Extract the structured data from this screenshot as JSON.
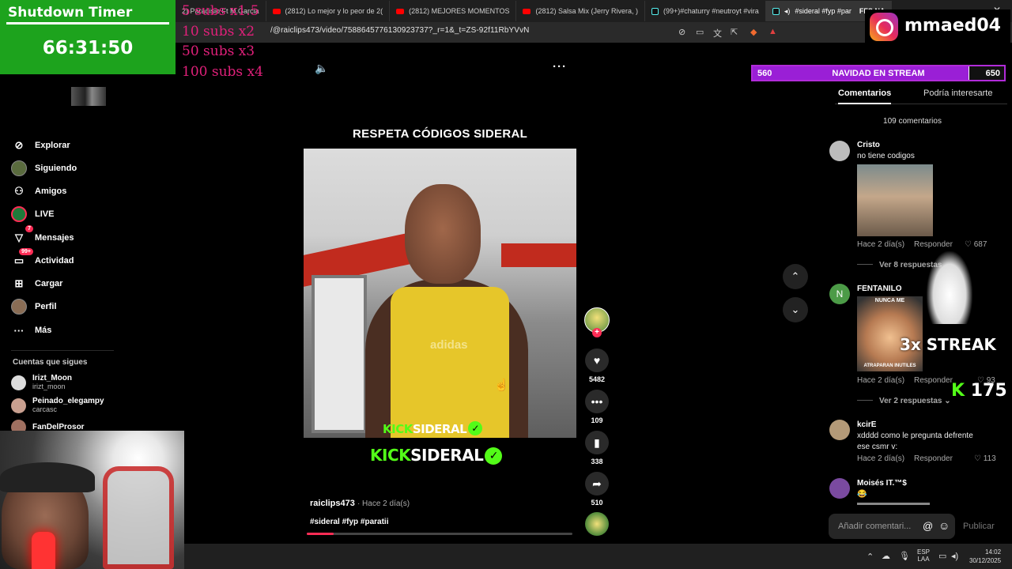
{
  "overlay": {
    "timer_title": "Shutdown Timer",
    "timer_value": "66:31:50",
    "subs_lines": [
      "5 subs x1.5",
      "10 subs x2",
      "50 subs x3",
      "100 subs x4"
    ],
    "instagram_handle": "mmaed04",
    "goal": {
      "left": "560",
      "title": "NAVIDAD EN STREAM",
      "right": "650",
      "progress_fraction": 0.86
    },
    "streak_text": "3x STREAK",
    "kick_count": "175"
  },
  "browser": {
    "tabs": [
      {
        "label": "2) Paradisio Ft M.Garcia",
        "icon": "youtube-icon",
        "active": false
      },
      {
        "label": "(2812) Lo mejor y lo peor de 2(",
        "icon": "youtube-icon",
        "active": false
      },
      {
        "label": "(2812) MEJORES MOMENTOS",
        "icon": "youtube-icon",
        "active": false
      },
      {
        "label": "(2812) Salsa Mix (Jerry Rivera, )",
        "icon": "youtube-icon",
        "active": false
      },
      {
        "label": "(99+)#chaturry #neutroyt #vira",
        "icon": "tiktok-icon",
        "active": false
      },
      {
        "label": "#sideral #fyp #par",
        "icon": "tiktok-icon",
        "active": true
      }
    ],
    "url": "/@raiclips473/video/7588645776130923737?_r=1&_t=ZS-92f11RbYVvN",
    "tab_overflow_text": "FFS NA"
  },
  "sidebar": {
    "items": [
      {
        "label": "Explorar",
        "icon": "compass-icon"
      },
      {
        "label": "Siguiendo",
        "icon": "following-avatar-icon"
      },
      {
        "label": "Amigos",
        "icon": "friends-icon"
      },
      {
        "label": "LIVE",
        "icon": "live-icon"
      },
      {
        "label": "Mensajes",
        "icon": "messages-icon",
        "badge": "7"
      },
      {
        "label": "Actividad",
        "icon": "activity-icon",
        "badge": "99+"
      },
      {
        "label": "Cargar",
        "icon": "upload-icon"
      },
      {
        "label": "Perfil",
        "icon": "profile-icon"
      },
      {
        "label": "Más",
        "icon": "more-icon"
      }
    ],
    "following_header": "Cuentas que sigues",
    "accounts": [
      {
        "name": "Irizt_Moon",
        "handle": "irizt_moon"
      },
      {
        "name": "Peinado_elegampy",
        "handle": "carcasc"
      },
      {
        "name": "FanDelProsor",
        "handle": ""
      }
    ]
  },
  "video": {
    "title": "RESPETA CÓDIGOS SIDERAL",
    "watermark_inner_green": "KICK",
    "watermark_inner_white": "SIDERAL",
    "watermark_outer_green": "KICK",
    "watermark_outer_white": "SIDERAL",
    "shirt_brand": "adidas",
    "author": "raiclips473",
    "posted": "· Hace 2 día(s)",
    "hashtags": "#sideral #fyp #paratii",
    "progress_fraction": 0.1,
    "actions": {
      "likes": "5482",
      "comments": "109",
      "saves": "338",
      "shares": "510"
    }
  },
  "comments": {
    "tab_active": "Comentarios",
    "tab_other": "Podría interesarte",
    "count_label": "109 comentarios",
    "items": [
      {
        "user": "Cristo",
        "text": "no tiene codigos",
        "time": "Hace 2 día(s)",
        "reply": "Responder",
        "likes": "687",
        "replies": "Ver 8 respuestas"
      },
      {
        "user": "FENTANILO",
        "text": "",
        "time": "Hace 2 día(s)",
        "reply": "Responder",
        "likes": "93",
        "replies": "Ver 2 respuestas",
        "image_top_text": "NUNCA ME",
        "image_bottom_text": "ATRAPARAN INUTILES"
      },
      {
        "user": "kcirE",
        "text": "xdddd como le pregunta defrente ese csmr v:",
        "time": "Hace 2 día(s)",
        "reply": "Responder",
        "likes": "113"
      },
      {
        "user": "Moisés IT.™$",
        "text": "😂"
      }
    ],
    "input_placeholder": "Añadir comentari...",
    "publish_label": "Publicar"
  },
  "taskbar": {
    "lang_top": "ESP",
    "lang_bottom": "LAA",
    "time": "14:02",
    "date": "30/12/2025"
  }
}
